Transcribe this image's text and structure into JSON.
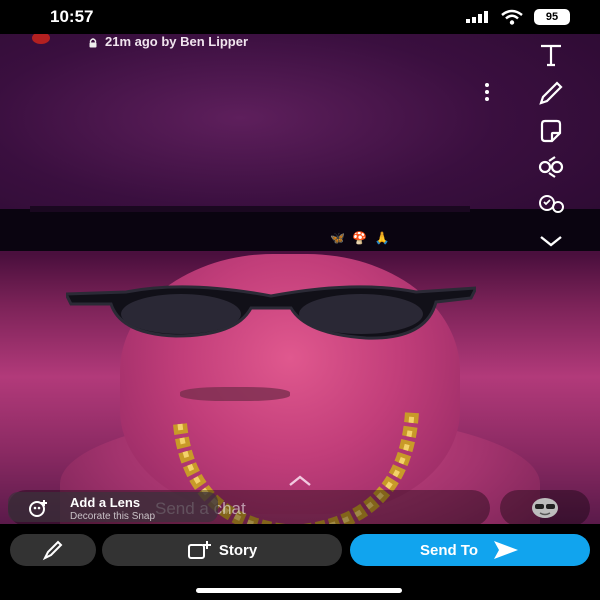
{
  "status_bar": {
    "time": "10:57",
    "battery": "95"
  },
  "header": {
    "meta": "21m ago by Ben Lipper"
  },
  "tools": [
    "text-icon",
    "pencil-icon",
    "sticker-icon",
    "scissors-icon",
    "music-icon",
    "chevron-down-icon"
  ],
  "lens": {
    "title": "Add a Lens",
    "subtitle": "Decorate this Snap"
  },
  "chat": {
    "placeholder": "Send a chat"
  },
  "actions": {
    "story_label": "Story",
    "send_label": "Send To"
  },
  "colors": {
    "send_blue": "#11a4ee",
    "pill_gray": "#333333"
  }
}
